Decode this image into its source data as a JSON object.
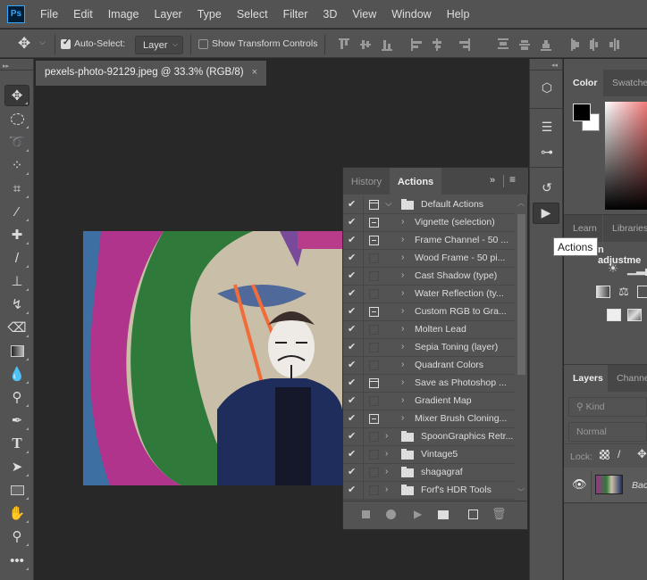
{
  "app": {
    "logo": "Ps"
  },
  "menu": [
    "File",
    "Edit",
    "Image",
    "Layer",
    "Type",
    "Select",
    "Filter",
    "3D",
    "View",
    "Window",
    "Help"
  ],
  "options": {
    "auto_select_label": "Auto-Select:",
    "auto_select_checked": true,
    "layer_select_value": "Layer",
    "show_transform_label": "Show Transform Controls",
    "show_transform_checked": false
  },
  "document": {
    "tab_title": "pexels-photo-92129.jpeg @ 33.3% (RGB/8)",
    "close": "×"
  },
  "tools": [
    "move",
    "marquee",
    "lasso",
    "quick-selection",
    "crop",
    "eyedropper",
    "healing-brush",
    "brush",
    "clone-stamp",
    "history-brush",
    "eraser",
    "gradient",
    "blur",
    "dodge",
    "pen",
    "type",
    "path-selection",
    "rectangle",
    "hand",
    "zoom",
    "more"
  ],
  "actions_panel": {
    "tabs": [
      {
        "label": "History",
        "active": false
      },
      {
        "label": "Actions",
        "active": true
      }
    ],
    "items": [
      {
        "label": "Default Actions",
        "type": "set",
        "expanded": true,
        "checked": true,
        "dialog": "set"
      },
      {
        "label": "Vignette (selection)",
        "type": "action",
        "checked": true,
        "dialog": "on"
      },
      {
        "label": "Frame Channel - 50 ...",
        "type": "action",
        "checked": true,
        "dialog": "on"
      },
      {
        "label": "Wood Frame - 50 pi...",
        "type": "action",
        "checked": true,
        "dialog": "off"
      },
      {
        "label": "Cast Shadow (type)",
        "type": "action",
        "checked": true,
        "dialog": "off"
      },
      {
        "label": "Water Reflection (ty...",
        "type": "action",
        "checked": true,
        "dialog": "off"
      },
      {
        "label": "Custom RGB to Gra...",
        "type": "action",
        "checked": true,
        "dialog": "on"
      },
      {
        "label": "Molten Lead",
        "type": "action",
        "checked": true,
        "dialog": "off"
      },
      {
        "label": "Sepia Toning (layer)",
        "type": "action",
        "checked": true,
        "dialog": "off"
      },
      {
        "label": "Quadrant Colors",
        "type": "action",
        "checked": true,
        "dialog": "off"
      },
      {
        "label": "Save as Photoshop ...",
        "type": "action",
        "checked": true,
        "dialog": "box"
      },
      {
        "label": "Gradient Map",
        "type": "action",
        "checked": true,
        "dialog": "off"
      },
      {
        "label": "Mixer Brush Cloning...",
        "type": "action",
        "checked": true,
        "dialog": "on"
      },
      {
        "label": "SpoonGraphics Retr...",
        "type": "set",
        "expanded": false,
        "checked": true,
        "dialog": "off"
      },
      {
        "label": "Vintage5",
        "type": "set",
        "expanded": false,
        "checked": true,
        "dialog": "off"
      },
      {
        "label": "shagagraf",
        "type": "set",
        "expanded": false,
        "checked": true,
        "dialog": "off"
      },
      {
        "label": "Forf's HDR Tools",
        "type": "set",
        "expanded": false,
        "checked": true,
        "dialog": "off"
      }
    ],
    "footer": [
      "stop",
      "record",
      "play",
      "new-set",
      "new-action",
      "delete"
    ]
  },
  "tooltip": "Actions",
  "right_panels": {
    "color_tabs": [
      "Color",
      "Swatches"
    ],
    "learn_tabs": [
      "Learn",
      "Libraries"
    ],
    "adjustments_label": "n adjustme",
    "layers_tabs": [
      "Layers",
      "Channels"
    ],
    "kind_filter": "Kind",
    "blend_mode": "Normal",
    "lock_label": "Lock:",
    "layer_name": "Bac"
  },
  "colors": {
    "foreground": "#000000",
    "background": "#ffffff"
  }
}
